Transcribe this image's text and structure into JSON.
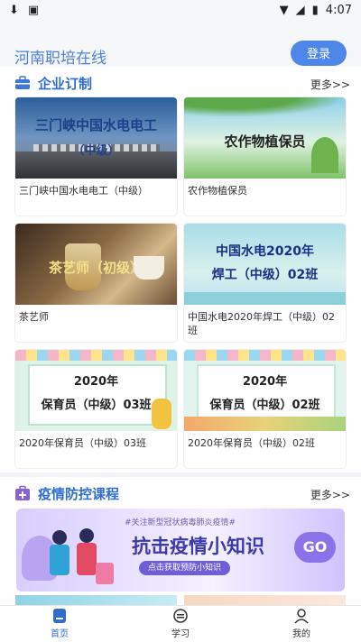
{
  "status": {
    "time": "4:07"
  },
  "header": {
    "app_title": "河南职培在线",
    "login_label": "登录"
  },
  "sections": {
    "enterprise": {
      "title": "企业订制",
      "more": "更多>>"
    },
    "epidemic": {
      "title": "疫情防控课程",
      "more": "更多>>"
    }
  },
  "courses": [
    {
      "thumb_line1": "三门峡中国水电电工",
      "thumb_line2": "（中级）",
      "caption": "三门峡中国水电电工（中级）"
    },
    {
      "thumb_line1": "农作物植保员",
      "thumb_line2": "",
      "caption": "农作物植保员"
    },
    {
      "thumb_line1": "茶艺师（初级）",
      "thumb_line2": "",
      "caption": "茶艺师"
    },
    {
      "thumb_line1": "中国水电2020年",
      "thumb_line2": "焊工（中级）02班",
      "caption": "中国水电2020年焊工（中级）02班"
    },
    {
      "thumb_line1": "2020年",
      "thumb_line2": "保育员（中级）03班",
      "caption": "2020年保育员（中级）03班"
    },
    {
      "thumb_line1": "2020年",
      "thumb_line2": "保育员（中级）02班",
      "caption": "2020年保育员（中级）02班"
    }
  ],
  "banner": {
    "tagline": "#关注新型冠状病毒肺炎疫情#",
    "headline": "抗击疫情小知识",
    "cta": "点击获取预防小知识",
    "go": "GO"
  },
  "tabs": [
    {
      "label": "首页",
      "active": true,
      "icon": "home-icon"
    },
    {
      "label": "学习",
      "active": false,
      "icon": "study-icon"
    },
    {
      "label": "我的",
      "active": false,
      "icon": "profile-icon"
    }
  ],
  "colors": {
    "accent": "#4f86ea",
    "title_blue": "#2f6dce"
  }
}
